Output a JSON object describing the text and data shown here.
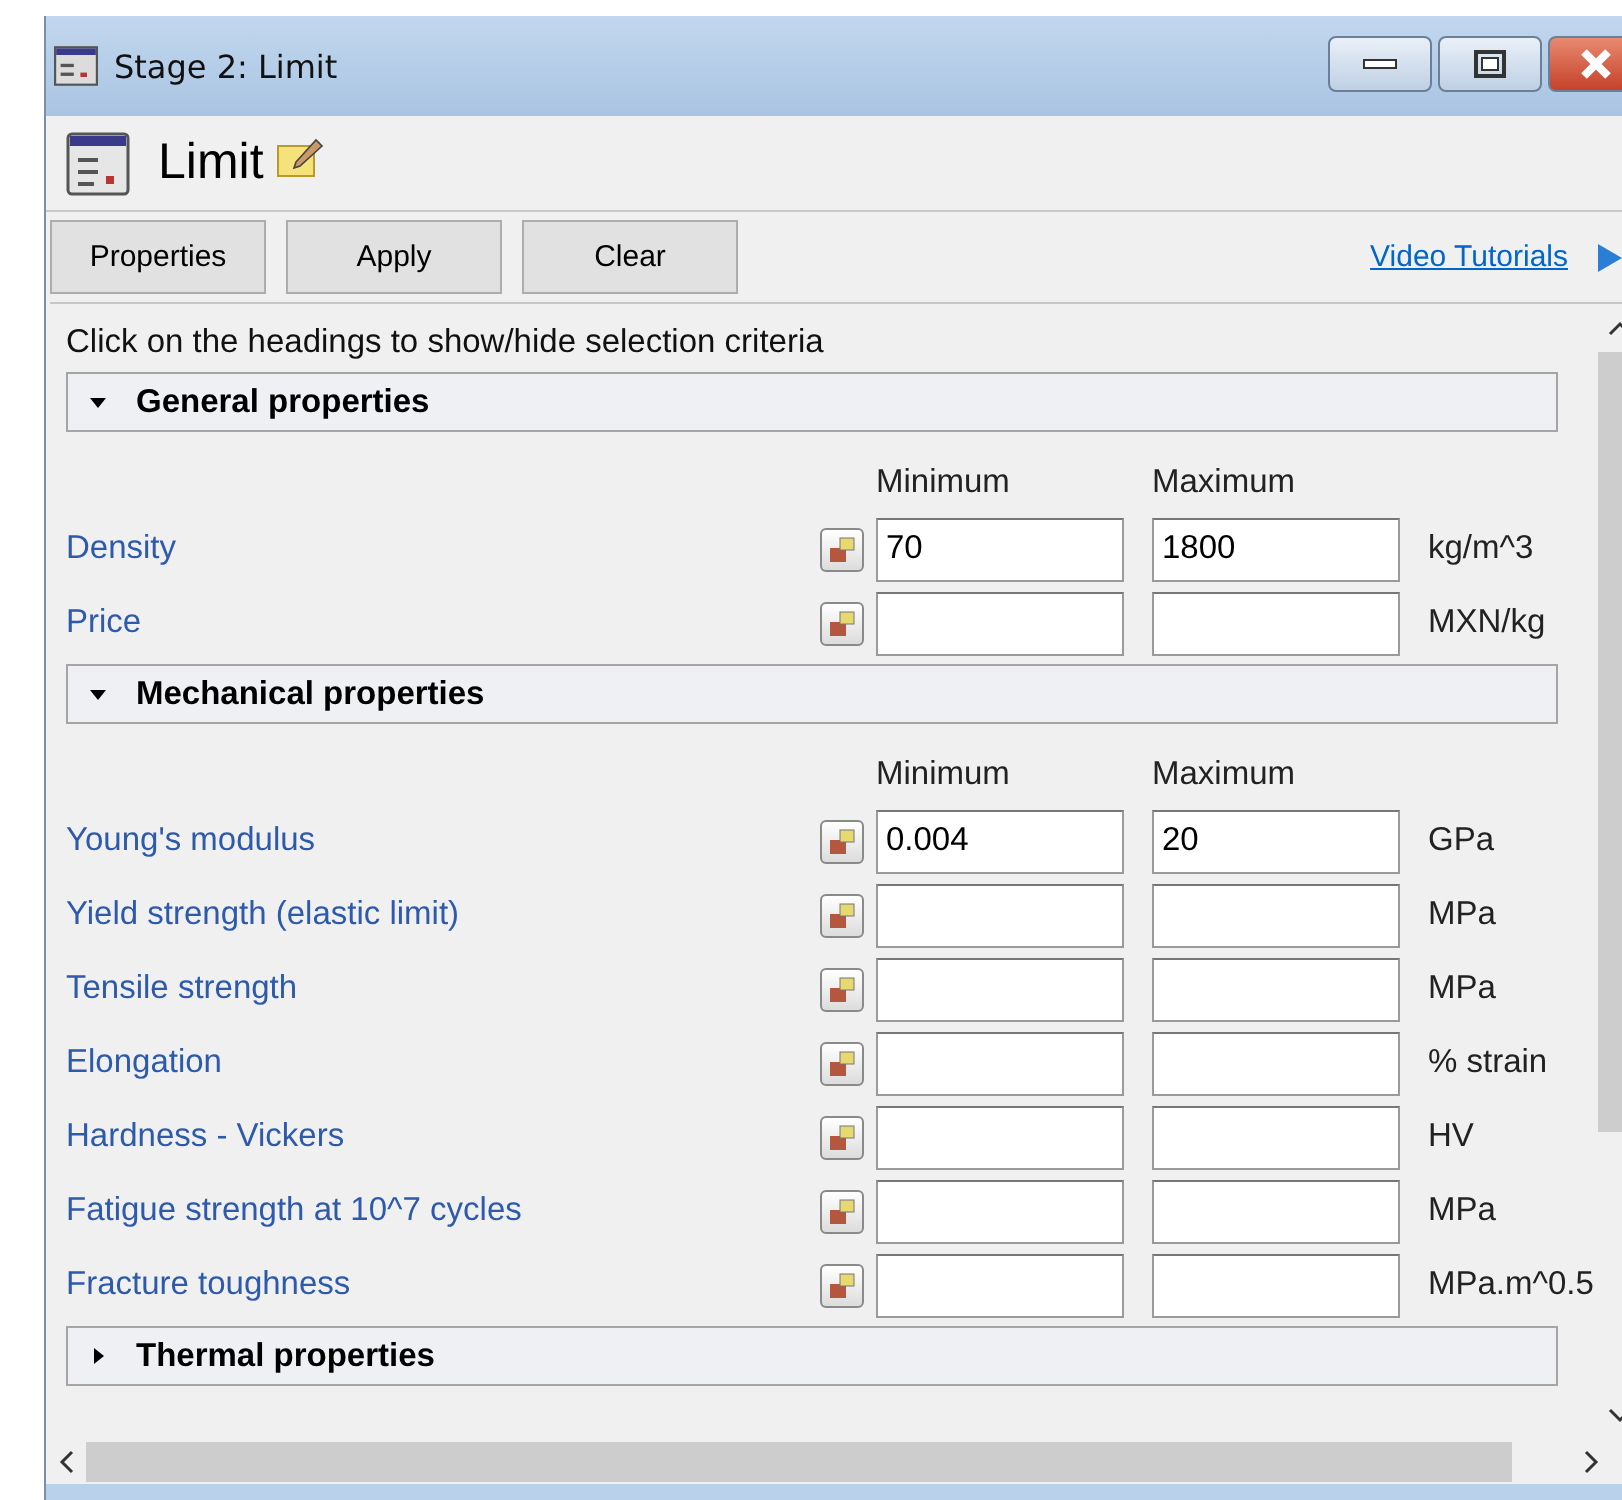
{
  "window": {
    "title": "Stage 2: Limit"
  },
  "header": {
    "title": "Limit"
  },
  "toolbar": {
    "buttons": [
      "Properties",
      "Apply",
      "Clear"
    ],
    "link": "Video Tutorials"
  },
  "hint": "Click on the headings to show/hide selection criteria",
  "sections": [
    {
      "title": "General properties",
      "expanded": true,
      "columns": [
        "Minimum",
        "Maximum"
      ],
      "rows": [
        {
          "label": "Density",
          "min": "70",
          "max": "1800",
          "unit": "kg/m^3"
        },
        {
          "label": "Price",
          "min": "",
          "max": "",
          "unit": "MXN/kg"
        }
      ]
    },
    {
      "title": "Mechanical properties",
      "expanded": true,
      "columns": [
        "Minimum",
        "Maximum"
      ],
      "rows": [
        {
          "label": "Young's modulus",
          "min": "0.004",
          "max": "20",
          "unit": "GPa"
        },
        {
          "label": "Yield strength (elastic limit)",
          "min": "",
          "max": "",
          "unit": "MPa"
        },
        {
          "label": "Tensile strength",
          "min": "",
          "max": "",
          "unit": "MPa"
        },
        {
          "label": "Elongation",
          "min": "",
          "max": "",
          "unit": "% strain"
        },
        {
          "label": "Hardness - Vickers",
          "min": "",
          "max": "",
          "unit": "HV"
        },
        {
          "label": "Fatigue strength at 10^7 cycles",
          "min": "",
          "max": "",
          "unit": "MPa"
        },
        {
          "label": "Fracture toughness",
          "min": "",
          "max": "",
          "unit": "MPa.m^0.5"
        }
      ]
    },
    {
      "title": "Thermal properties",
      "expanded": false
    }
  ]
}
